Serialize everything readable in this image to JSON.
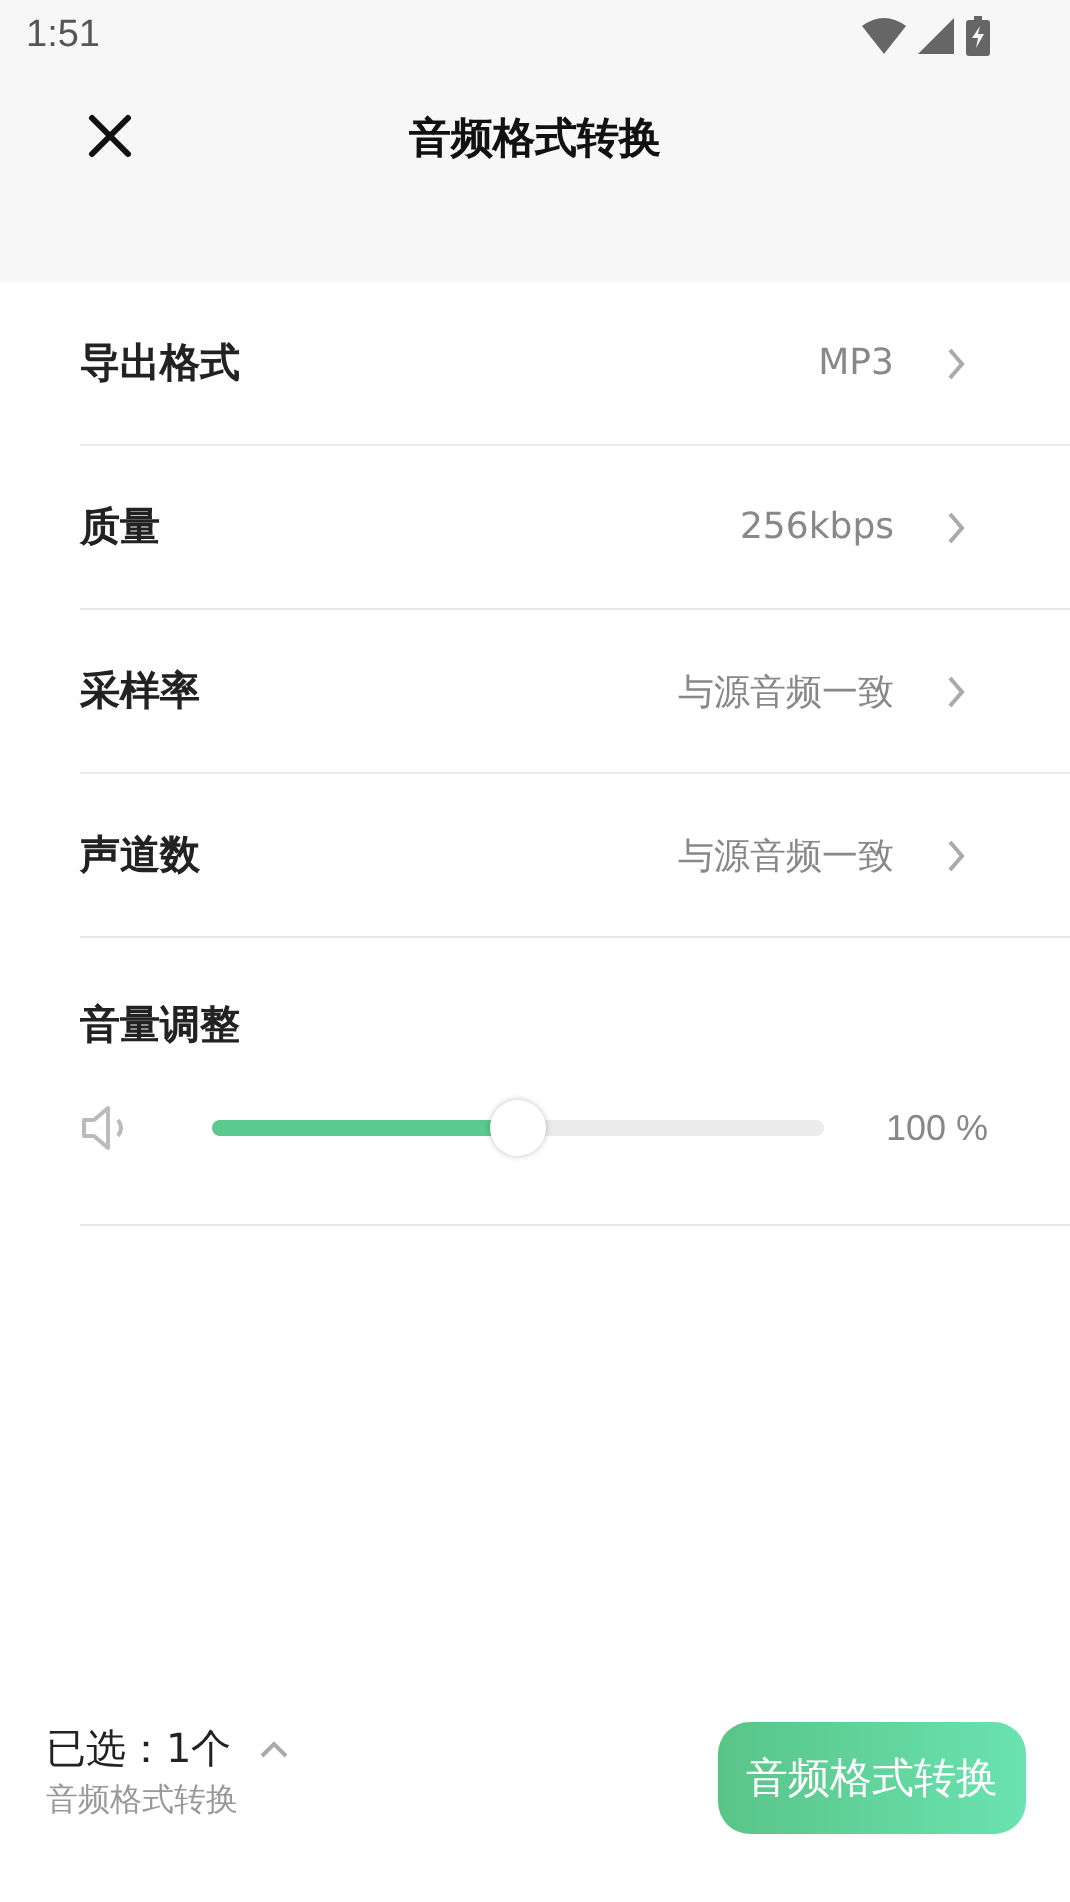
{
  "status_bar": {
    "time": "1:51"
  },
  "header": {
    "title": "音频格式转换"
  },
  "settings": [
    {
      "label": "导出格式",
      "value": "MP3"
    },
    {
      "label": "质量",
      "value": "256kbps"
    },
    {
      "label": "采样率",
      "value": "与源音频一致"
    },
    {
      "label": "声道数",
      "value": "与源音频一致"
    }
  ],
  "volume": {
    "title": "音量调整",
    "level": 0.5,
    "reading": "100 %"
  },
  "footer": {
    "selected": "已选：1个",
    "subtitle": "音频格式转换",
    "button": "音频格式转换"
  }
}
